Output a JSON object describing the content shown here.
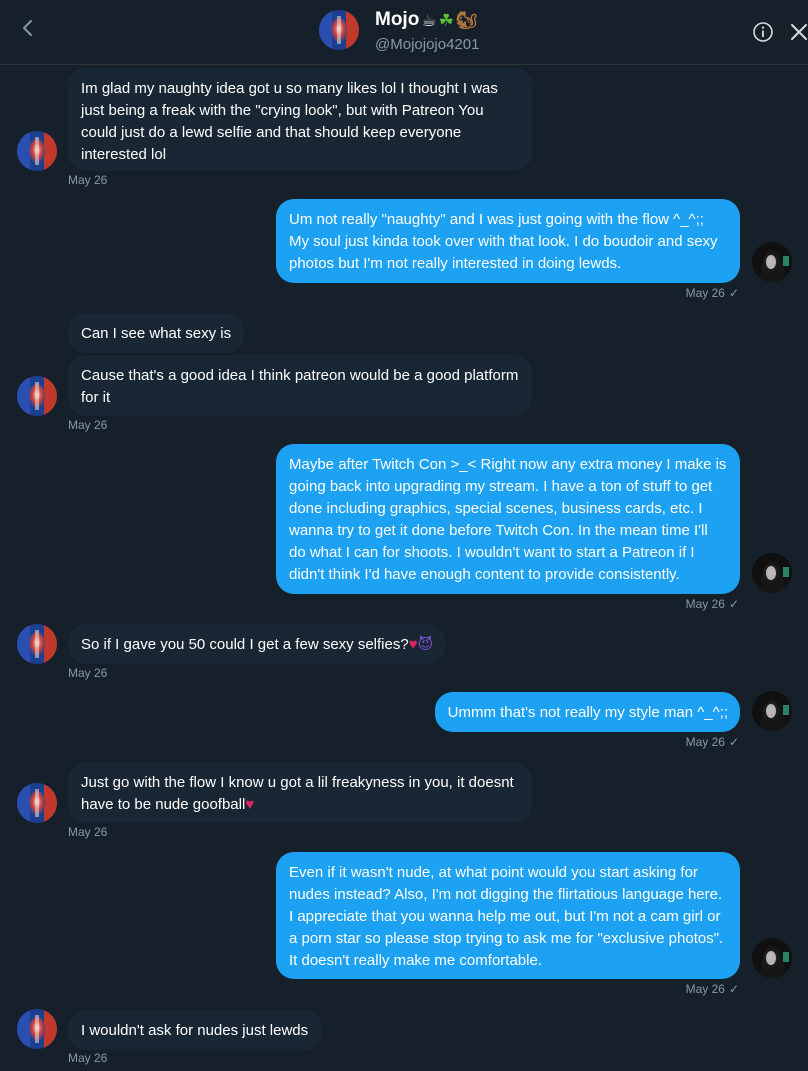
{
  "header": {
    "name": "Mojo",
    "name_emojis": [
      "☕",
      "☘",
      "🐿"
    ],
    "handle": "@Mojojojo4201",
    "icons": [
      "back-arrow-icon",
      "info-icon",
      "close-icon"
    ]
  },
  "colors": {
    "background": "#15202b",
    "incoming_bubble": "#192734",
    "outgoing_bubble": "#1da1f2",
    "muted_text": "#8899a6"
  },
  "messages": [
    {
      "dir": "in",
      "text": "Im glad my naughty idea got u so many likes lol I thought I was just being a freak with the \"crying look\", but with Patreon You could just do a lewd selfie and that should keep everyone interested lol"
    },
    {
      "dir": "in",
      "stamp": "May 26"
    },
    {
      "dir": "out",
      "text": "Um not really \"naughty\" and I was just going with the flow ^_^;; My soul just kinda took over with that look. I do boudoir and sexy photos but I'm not really interested in doing lewds."
    },
    {
      "dir": "out",
      "stamp": "May 26"
    },
    {
      "dir": "in",
      "text": "Can I see what sexy is"
    },
    {
      "dir": "in",
      "text": "Cause that's a good idea I think patreon would be a good platform for it"
    },
    {
      "dir": "in",
      "stamp": "May 26"
    },
    {
      "dir": "out",
      "text": "Maybe after Twitch Con >_< Right now any extra money I make is going back into upgrading my stream. I have a ton of stuff to get done including graphics, special scenes, business cards, etc. I wanna try to get it done before Twitch Con. In the mean time I'll do what I can for shoots. I wouldn't want to start a Patreon if I didn't think I'd have enough content to provide consistently."
    },
    {
      "dir": "out",
      "stamp": "May 26"
    },
    {
      "dir": "in",
      "text": "So if I gave you 50 could I get a few sexy selfies?"
    },
    {
      "dir": "in",
      "stamp": "May 26"
    },
    {
      "dir": "out",
      "text": "Ummm that's not really my style man ^_^;;"
    },
    {
      "dir": "out",
      "stamp": "May 26"
    },
    {
      "dir": "in",
      "text": "Just go with the flow I know u got a lil freakyness in you, it doesnt have to be nude goofball"
    },
    {
      "dir": "in",
      "stamp": "May 26"
    },
    {
      "dir": "out",
      "text": "Even if it wasn't nude, at what point would you start asking for nudes instead? Also, I'm not digging the flirtatious language here. I appreciate that you wanna help me out, but I'm not a cam girl or a porn star so please stop trying to ask me for \"exclusive photos\". It doesn't really make me comfortable."
    },
    {
      "dir": "out",
      "stamp": "May 26"
    },
    {
      "dir": "in",
      "text": "I wouldn't ask for nudes just lewds"
    },
    {
      "dir": "in",
      "stamp": "May 26"
    }
  ],
  "read_receipt_icon": "check-icon",
  "emojis": {
    "heart": "♥",
    "devil": "😈"
  }
}
